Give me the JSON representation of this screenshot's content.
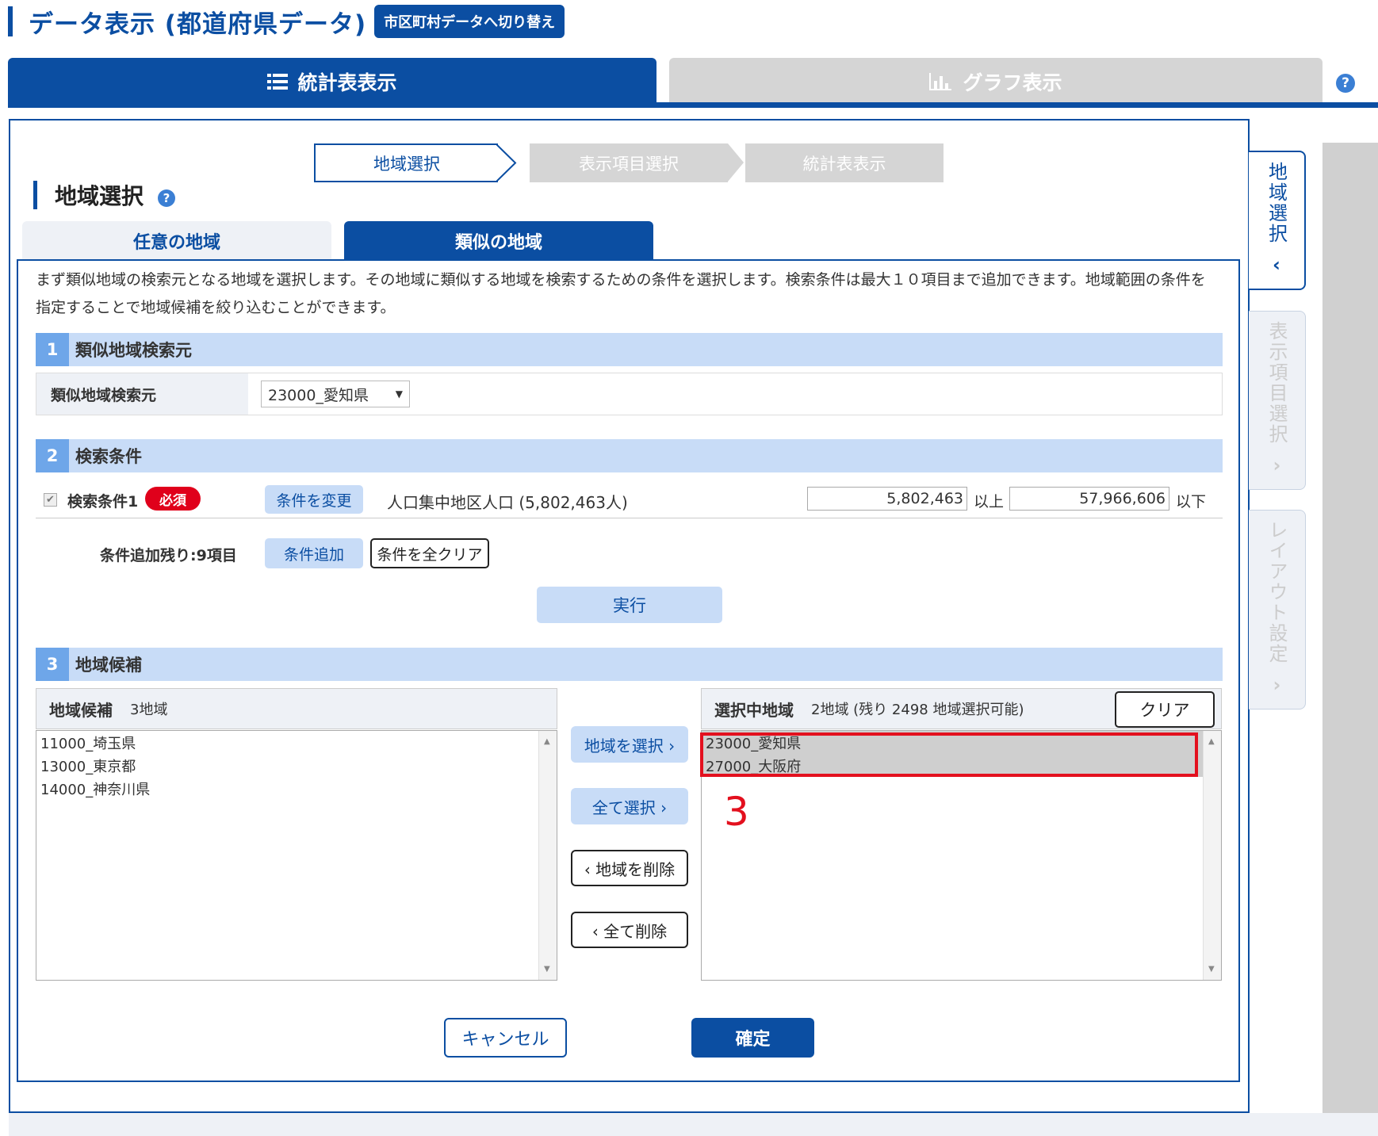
{
  "header": {
    "title": "データ表示 (都道府県データ)",
    "switch_label": "市区町村データへ切り替え"
  },
  "main_tabs": [
    {
      "label": "統計表表示",
      "icon": "list-icon",
      "active": true
    },
    {
      "label": "グラフ表示",
      "icon": "bar-chart-icon",
      "active": false
    }
  ],
  "help_icon": "?",
  "steps": [
    "地域選択",
    "表示項目選択",
    "統計表表示"
  ],
  "section_title": "地域選択",
  "sub_tabs": [
    "任意の地域",
    "類似の地域"
  ],
  "description": "まず類似地域の検索元となる地域を選択します。その地域に類似する地域を検索するための条件を選択します。検索条件は最大１０項目まで追加できます。地域範囲の条件を指定することで地域候補を絞り込むことができます。",
  "section1": {
    "num": "1",
    "title": "類似地域検索元",
    "row_label": "類似地域検索元",
    "select_value": "23000_愛知県",
    "select_arrow": "▼"
  },
  "section2": {
    "num": "2",
    "title": "検索条件",
    "checkmark": "✔",
    "condition_label": "検索条件1",
    "required_badge": "必須",
    "change_button": "条件を変更",
    "condition_desc": "人口集中地区人口 (5,802,463人)",
    "min_value": "5,802,463",
    "min_unit": "以上",
    "max_value": "57,966,606",
    "max_unit": "以下",
    "remaining_label": "条件追加残り:9項目",
    "add_button": "条件追加",
    "clear_all_button": "条件を全クリア",
    "execute_button": "実行"
  },
  "section3": {
    "num": "3",
    "title": "地域候補",
    "candidates_header": "地域候補",
    "candidates_count": "3地域",
    "candidates": [
      "11000_埼玉県",
      "13000_東京都",
      "14000_神奈川県"
    ],
    "selected_header": "選択中地域",
    "selected_count": "2地域 (残り 2498 地域選択可能)",
    "selected_clear": "クリア",
    "selected": [
      "23000_愛知県",
      "27000_大阪府"
    ],
    "select_button": "地域を選択 ›",
    "select_all_button": "全て選択 ›",
    "delete_button": "‹ 地域を削除",
    "delete_all_button": "‹ 全て削除"
  },
  "annotation": "3",
  "footer": {
    "cancel": "キャンセル",
    "ok": "確定"
  },
  "side_tabs": [
    {
      "label": "地域選択",
      "active": true,
      "chevron": "‹"
    },
    {
      "label": "表示項目選択",
      "active": false,
      "chevron": "›"
    },
    {
      "label": "レイアウト設定",
      "active": false,
      "chevron": "›"
    }
  ],
  "colors": {
    "primary": "#0b4ea2",
    "light": "#c8dcf7",
    "required": "#e0001b",
    "annotation": "#e3101e"
  }
}
